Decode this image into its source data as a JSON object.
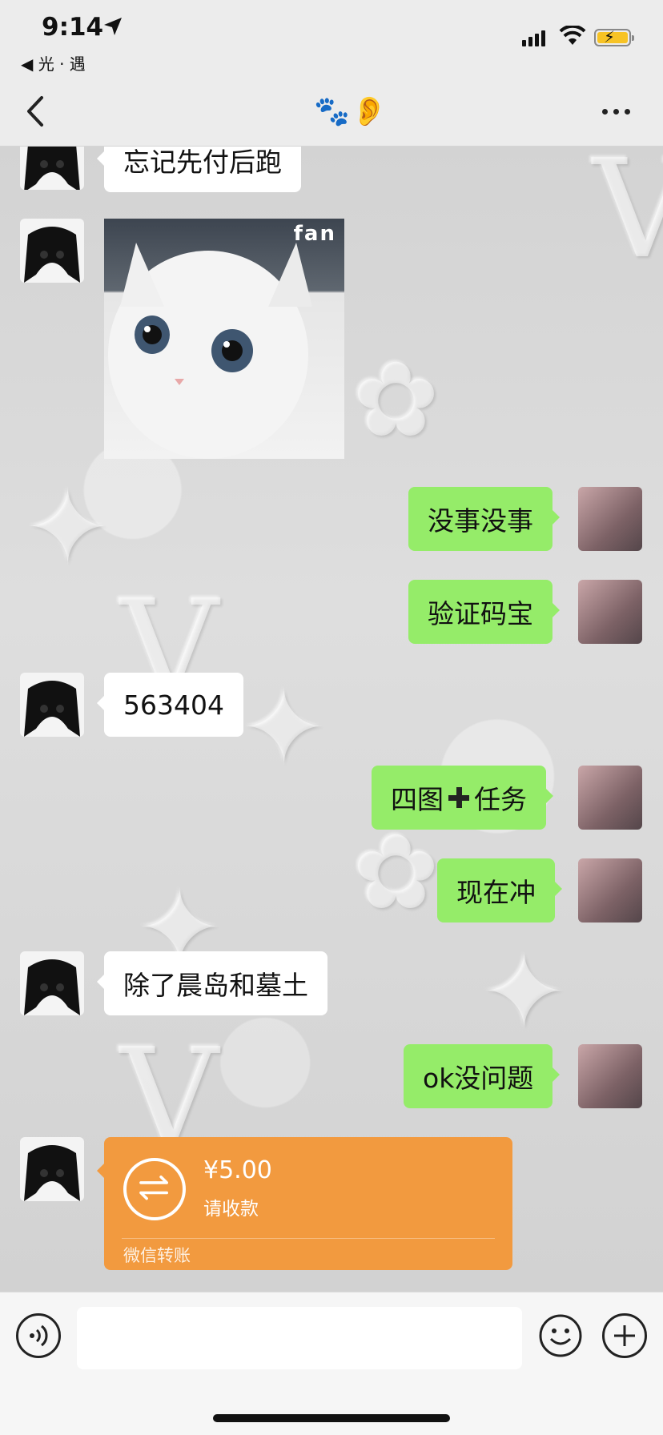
{
  "status_bar": {
    "time": "9:14",
    "back_app": "◀ 光 · 遇",
    "battery_color": "#f7c325"
  },
  "nav": {
    "title": "🐾👂",
    "icons": [
      "chevron-left-icon",
      "more-dots-icon"
    ]
  },
  "messages": [
    {
      "side": "left",
      "type": "text",
      "text": "忘记先付后跑"
    },
    {
      "side": "left",
      "type": "image",
      "caption": "fan"
    },
    {
      "side": "right",
      "type": "text",
      "text": "没事没事"
    },
    {
      "side": "right",
      "type": "text",
      "text": "验证码宝"
    },
    {
      "side": "left",
      "type": "text",
      "text": "563404"
    },
    {
      "side": "right",
      "type": "text",
      "text_before": "四图",
      "text_after": "任务"
    },
    {
      "side": "right",
      "type": "text",
      "text": "现在冲"
    },
    {
      "side": "left",
      "type": "text",
      "text": "除了晨岛和墓土"
    },
    {
      "side": "right",
      "type": "text",
      "text": "ok没问题"
    },
    {
      "side": "left",
      "type": "transfer",
      "amount": "¥5.00",
      "subtitle": "请收款",
      "footer": "微信转账"
    }
  ],
  "colors": {
    "sent_bubble": "#95ec69",
    "received_bubble": "#ffffff",
    "transfer_card": "#f29a3f"
  },
  "input_bar": {
    "icons": [
      "voice-icon",
      "emoji-icon",
      "add-icon"
    ],
    "placeholder": ""
  }
}
